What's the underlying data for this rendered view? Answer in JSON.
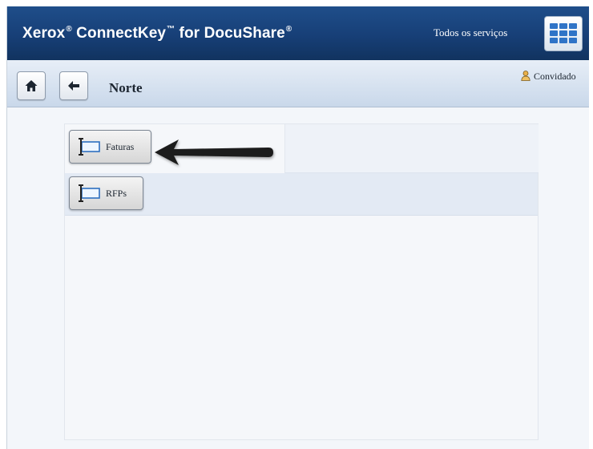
{
  "header": {
    "brand": {
      "xerox": "Xerox",
      "reg_mark": "®",
      "connectkey": "ConnectKey",
      "tm_mark": "™",
      "for": "for",
      "docushare": "DocuShare",
      "reg_mark2": "®"
    },
    "all_services_label": "Todos os serviços",
    "apps_icon": "apps-grid-icon"
  },
  "toolbar": {
    "home_icon": "home-icon",
    "back_icon": "back-arrow-icon",
    "location": "Norte",
    "user_icon": "user-icon",
    "user_label": "Convidado"
  },
  "folders": [
    {
      "label": "Faturas",
      "icon": "folder-icon"
    },
    {
      "label": "RFPs",
      "icon": "folder-icon"
    }
  ],
  "annotation": {
    "icon": "pointer-arrow"
  },
  "colors": {
    "header_bg": "#173f77",
    "subheader_bg": "#d5e1ef",
    "accent_blue": "#2f74c7"
  }
}
